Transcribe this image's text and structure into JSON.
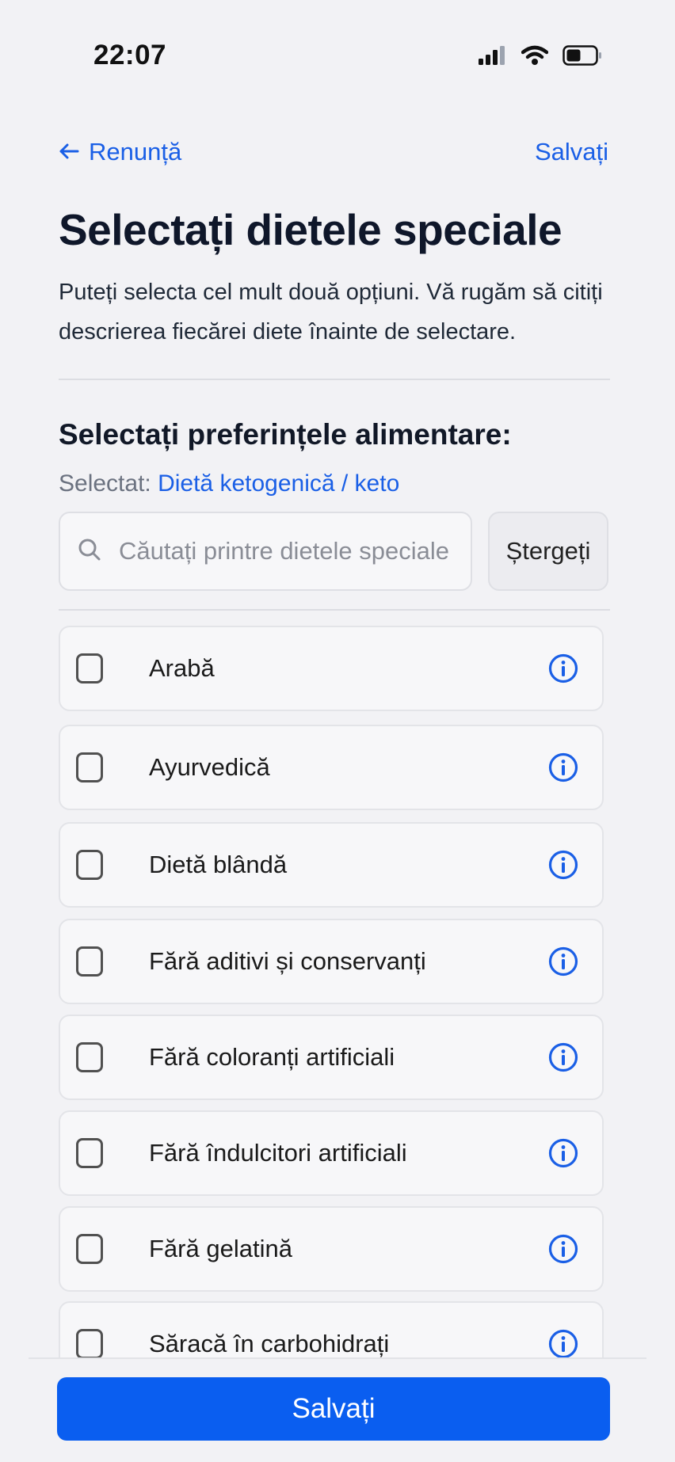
{
  "status_bar": {
    "time": "22:07",
    "icons": [
      "signal-icon",
      "wifi-icon",
      "battery-icon"
    ]
  },
  "nav": {
    "back_label": "Renunță",
    "save_label": "Salvați"
  },
  "header": {
    "title": "Selectați dietele speciale",
    "description": "Puteți selecta cel mult două opțiuni. Vă rugăm să citiți descrierea fiecărei diete înainte de selectare."
  },
  "preferences": {
    "title": "Selectați preferințele alimentare:",
    "selected_prefix": "Selectat:",
    "selected_value": "Dietă ketogenică / keto"
  },
  "search": {
    "placeholder": "Căutați printre dietele speciale",
    "clear_label": "Ștergeți"
  },
  "diets": [
    {
      "label": "Arabă",
      "checked": false
    },
    {
      "label": "Ayurvedică",
      "checked": false
    },
    {
      "label": "Dietă blândă",
      "checked": false
    },
    {
      "label": "Fără aditivi și conservanți",
      "checked": false
    },
    {
      "label": "Fără coloranți artificiali",
      "checked": false
    },
    {
      "label": "Fără îndulcitori artificiali",
      "checked": false
    },
    {
      "label": "Fără gelatină",
      "checked": false
    },
    {
      "label": "Săracă în carbohidrați",
      "checked": false
    }
  ],
  "footer": {
    "save_button_label": "Salvați"
  },
  "colors": {
    "accent": "#1a5fe6",
    "primary_button": "#0a5ef0",
    "background": "#f2f2f5"
  }
}
